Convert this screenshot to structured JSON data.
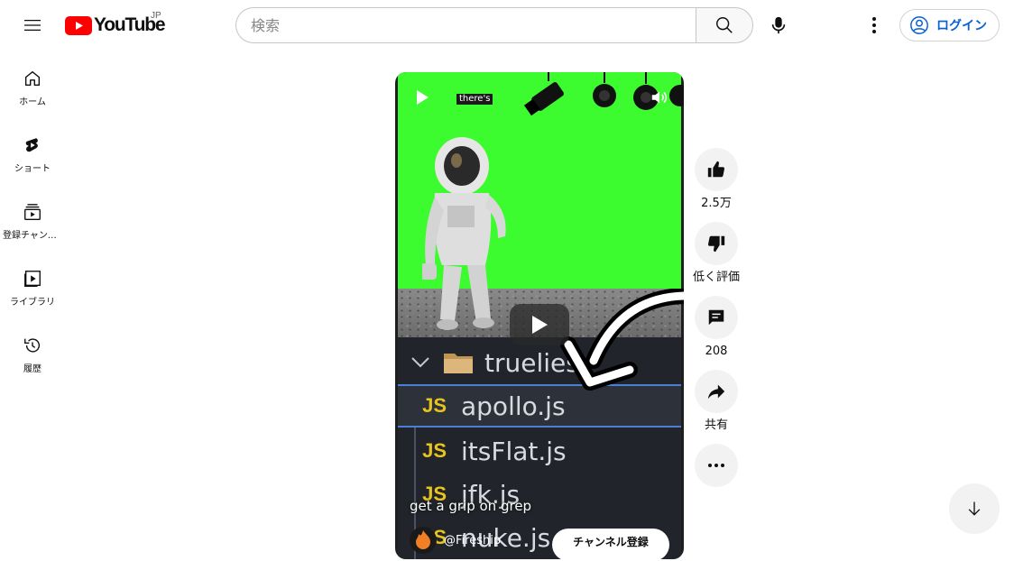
{
  "masthead": {
    "logo_text": "YouTube",
    "region_code": "JP",
    "search_placeholder": "検索",
    "signin_label": "ログイン"
  },
  "guide": {
    "items": [
      {
        "label": "ホーム",
        "icon": "home-icon"
      },
      {
        "label": "ショート",
        "icon": "shorts-icon"
      },
      {
        "label": "登録チャンネル",
        "icon": "subscriptions-icon"
      },
      {
        "label": "ライブラリ",
        "icon": "library-icon"
      },
      {
        "label": "履歴",
        "icon": "history-icon"
      }
    ]
  },
  "video": {
    "caption_text": "there's",
    "title": "get a grip on grep",
    "channel_name": "@Fireship",
    "subscribe_label": "チャンネル登録",
    "tree": {
      "folder": "truelies",
      "files": [
        "apollo.js",
        "itsFlat.js",
        "jfk.js",
        "nuke.js"
      ],
      "badge": "JS"
    }
  },
  "actions": {
    "like_count": "2.5万",
    "dislike_label": "低く評価",
    "comment_count": "208",
    "share_label": "共有"
  },
  "colors": {
    "brand_red": "#ff0000",
    "chroma_green": "#3cfc2f",
    "link_blue": "#065fd4"
  }
}
